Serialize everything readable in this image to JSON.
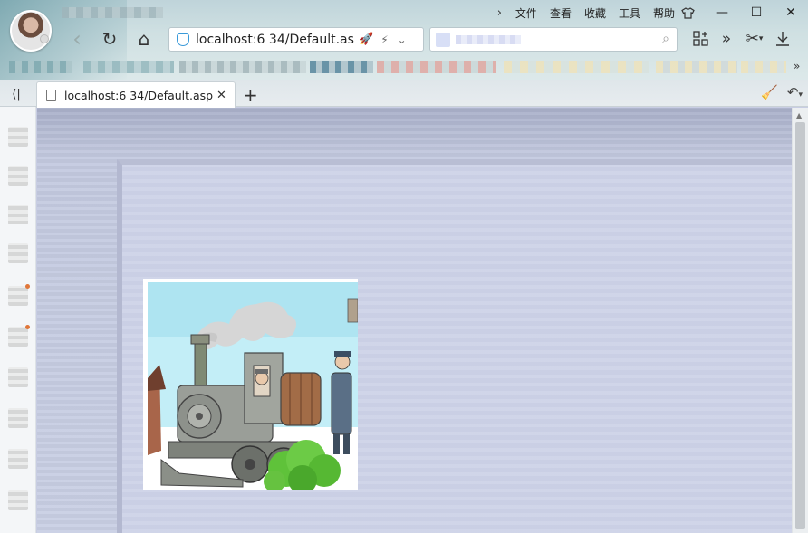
{
  "menu": {
    "items": [
      "文件",
      "查看",
      "收藏",
      "工具",
      "帮助"
    ]
  },
  "window_controls": {
    "skin_icon": "shirt-icon",
    "minimize": "—",
    "maximize": "☐",
    "close": "✕"
  },
  "navigation": {
    "back": "‹",
    "refresh": "↻",
    "home": "⌂"
  },
  "address_bar": {
    "url": "localhost:6   34/Default.as"
  },
  "search": {
    "placeholder": ""
  },
  "tabs": [
    {
      "title": "localhost:6   34/Default.asp",
      "close": "✕"
    }
  ],
  "tab_strip": {
    "collapse": "⟨|",
    "new_tab": "+"
  },
  "page": {
    "background_color": "#c9cfe4",
    "image_description_icon": "train-illustration"
  },
  "colors": {
    "accent": "#3a9ad9",
    "notification_dot": "#e0773a"
  }
}
